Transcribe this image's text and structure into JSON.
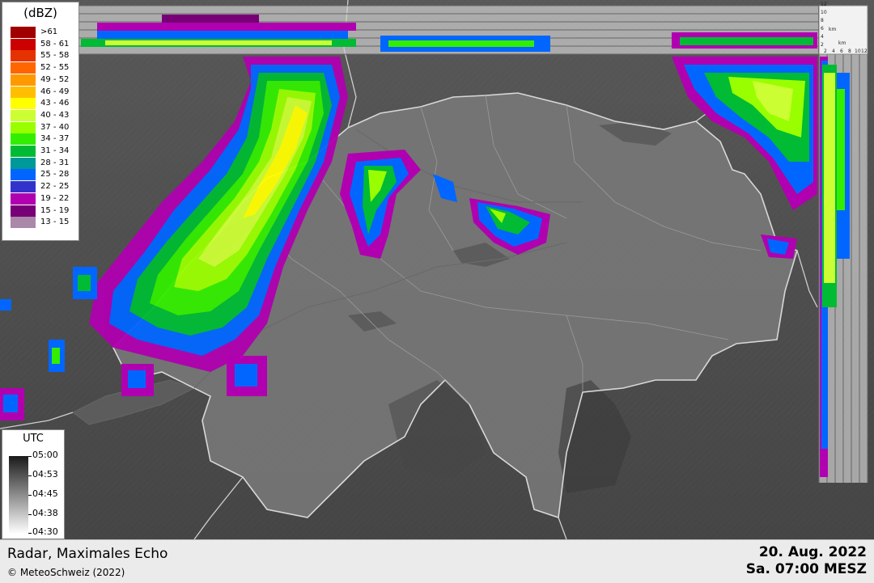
{
  "dbz_legend": {
    "title": "(dBZ)",
    "items": [
      {
        "label": ">61",
        "color": "#a00000"
      },
      {
        "label": "58 - 61",
        "color": "#cc0000"
      },
      {
        "label": "55 - 58",
        "color": "#e63200"
      },
      {
        "label": "52 - 55",
        "color": "#ff6600"
      },
      {
        "label": "49 - 52",
        "color": "#ff9900"
      },
      {
        "label": "46 - 49",
        "color": "#ffbf00"
      },
      {
        "label": "43 - 46",
        "color": "#ffff00"
      },
      {
        "label": "40 - 43",
        "color": "#ccff33"
      },
      {
        "label": "37 - 40",
        "color": "#99ff00"
      },
      {
        "label": "34 - 37",
        "color": "#33ee00"
      },
      {
        "label": "31 - 34",
        "color": "#00bb33"
      },
      {
        "label": "28 - 31",
        "color": "#009999"
      },
      {
        "label": "25 - 28",
        "color": "#0066ff"
      },
      {
        "label": "22 - 25",
        "color": "#3333cc"
      },
      {
        "label": "19 - 22",
        "color": "#b000b0"
      },
      {
        "label": "15 - 19",
        "color": "#770077"
      },
      {
        "label": "13 - 15",
        "color": "#aa88aa"
      }
    ]
  },
  "utc_legend": {
    "title": "UTC",
    "labels": [
      "05:00",
      "04:53",
      "04:45",
      "04:38",
      "04:30"
    ]
  },
  "side_profile": {
    "height_ticks": [
      "12",
      "10",
      "8",
      "6",
      "4",
      "2"
    ],
    "km_label": "km",
    "km_label_2": "km",
    "bottom_ticks": [
      "2",
      "4",
      "6",
      "8",
      "10",
      "12"
    ]
  },
  "footer": {
    "title": "Radar, Maximales Echo",
    "copyright": "© MeteoSchweiz (2022)",
    "date": "20. Aug. 2022",
    "local_time": "Sa. 07:00 MESZ"
  }
}
